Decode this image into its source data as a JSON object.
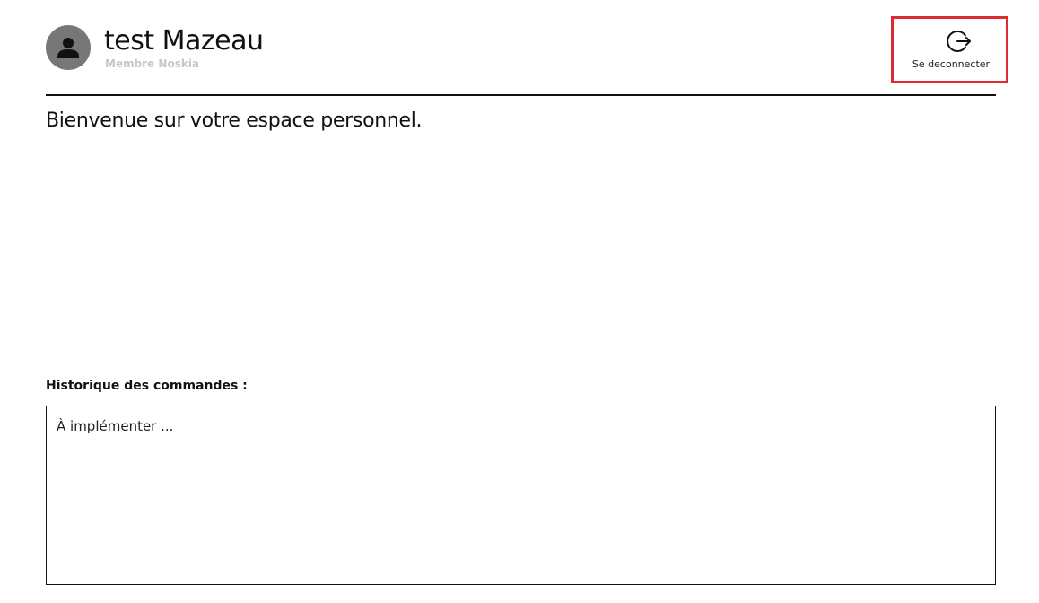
{
  "user": {
    "name": "test Mazeau",
    "role": "Membre Noskia",
    "avatar_icon": "person-icon"
  },
  "logout": {
    "label": "Se deconnecter",
    "icon": "logout-icon",
    "highlight_color": "#e02b36"
  },
  "main": {
    "welcome": "Bienvenue sur votre espace personnel."
  },
  "orders": {
    "label": "Historique des commandes :",
    "content": "À implémenter ..."
  }
}
